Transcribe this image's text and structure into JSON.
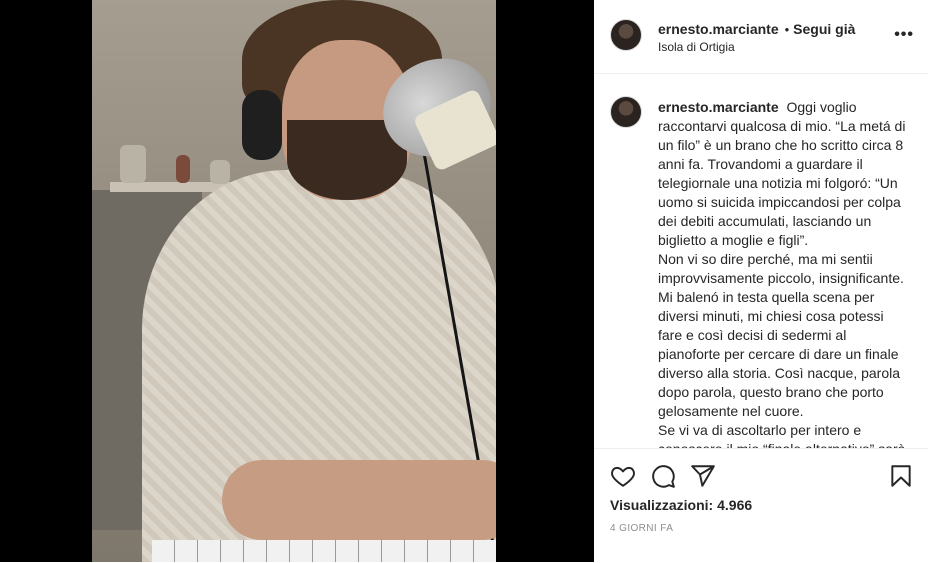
{
  "post": {
    "username": "ernesto.marciante",
    "follow_status": "Segui già",
    "location": "Isola di Ortigia",
    "more_label": "•••",
    "caption_lines": [
      "Oggi voglio raccontarvi qualcosa di mio. “La metá di un filo” è un brano che ho scritto circa 8 anni fa. Trovandomi a guardare il telegiornale una notizia mi folgoró: “Un uomo si suicida impiccandosi per colpa dei debiti accumulati, lasciando un biglietto a moglie e figli”.",
      "Non vi so dire perché, ma mi sentii improvvisamente piccolo, insignificante. Mi balenó in testa quella scena per diversi minuti, mi chiesi cosa potessi fare e così decisi di sedermi al pianoforte per cercare di dare un finale diverso alla storia. Così nacque, parola dopo parola, questo brano che porto gelosamente nel cuore.",
      "Se vi va di ascoltarlo per intero e conoscere il mio “finale alternativo” sarà ben lieto di registrarlo in versione"
    ],
    "views_label": "Visualizzazioni:",
    "views_count": "4.966",
    "time_ago": "4 GIORNI FA"
  },
  "icons": {
    "like": "heart-icon",
    "comment": "comment-icon",
    "share": "share-icon",
    "save": "bookmark-icon",
    "more": "more-icon"
  },
  "colors": {
    "text": "#262626",
    "secondary": "#8e8e8e",
    "border": "#efefef"
  }
}
